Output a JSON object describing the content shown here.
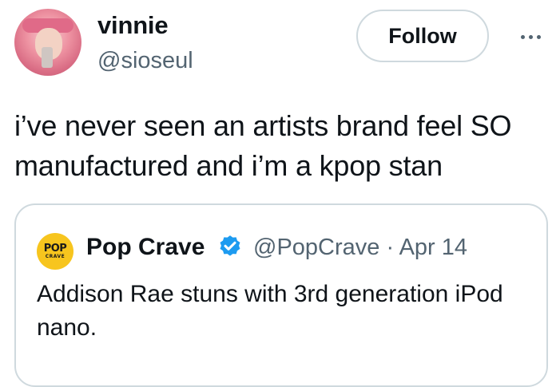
{
  "author": {
    "name": "vinnie",
    "handle": "@sioseul",
    "avatar_icon": "user-avatar"
  },
  "actions": {
    "follow_label": "Follow",
    "more_icon": "more-horizontal-icon"
  },
  "tweet": {
    "text": "i’ve never seen an artists brand feel SO manufactured and i’m a kpop stan"
  },
  "quote": {
    "logo_text_top": "POP",
    "logo_text_bottom": "CRAVE",
    "name": "Pop Crave",
    "verified_icon": "verified-badge-icon",
    "verified_color": "#1d9bf0",
    "handle_date": "@PopCrave · Apr 14",
    "text": "Addison Rae stuns with 3rd generation iPod nano."
  },
  "colors": {
    "text_primary": "#0f1419",
    "text_secondary": "#536471",
    "border": "#cfd9de",
    "logo_yellow": "#f7c51e"
  }
}
